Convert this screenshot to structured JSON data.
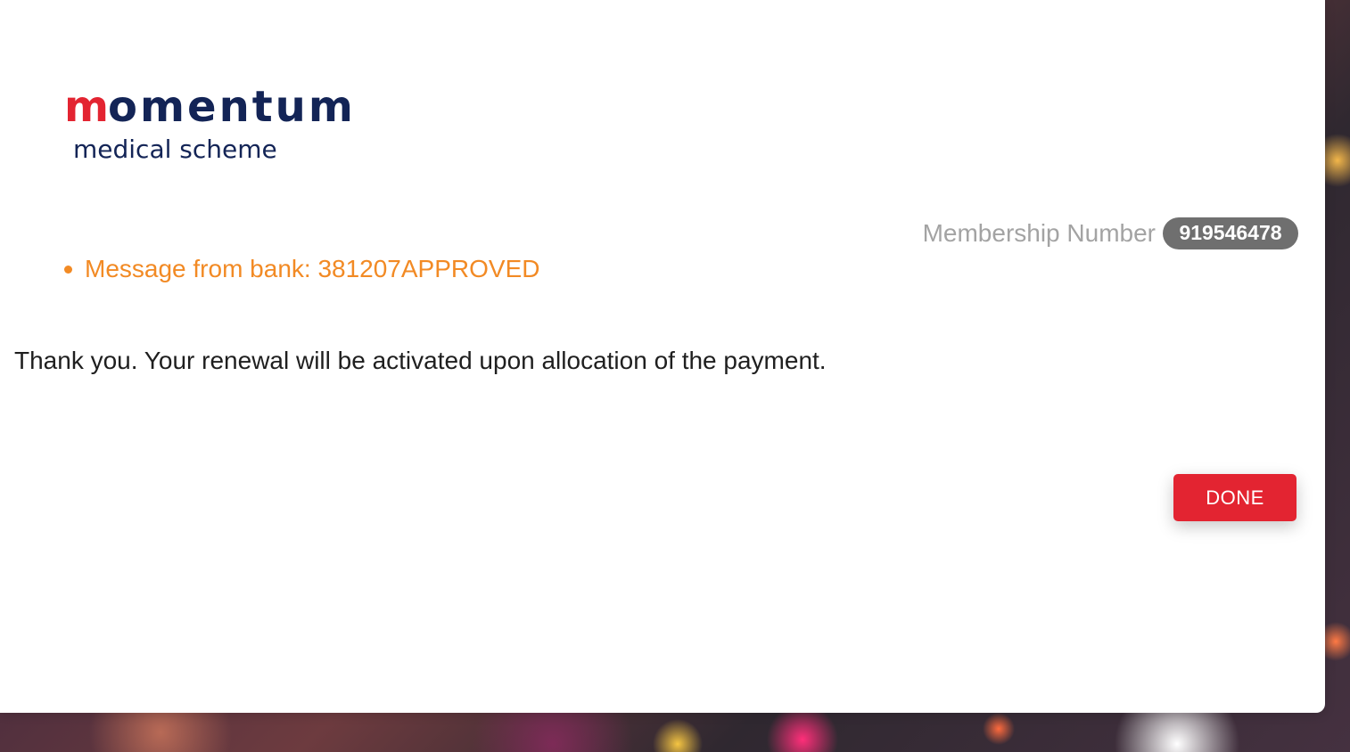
{
  "logo": {
    "brand_first": "m",
    "brand_rest": "omentum",
    "subtitle": "medical scheme",
    "colors": {
      "brand_red": "#e32431",
      "brand_navy": "#132456"
    }
  },
  "membership": {
    "label": "Membership Number",
    "number": "919546478"
  },
  "messages": [
    "Message from bank: 381207APPROVED"
  ],
  "main": {
    "confirmation_text": "Thank you. Your renewal will be activated upon allocation of the payment."
  },
  "actions": {
    "done_label": "DONE"
  },
  "colors": {
    "accent": "#f28a24",
    "button": "#e32431",
    "badge": "#6f6f6f"
  },
  "icons": {
    "bullet": "bullet-dot-icon"
  }
}
